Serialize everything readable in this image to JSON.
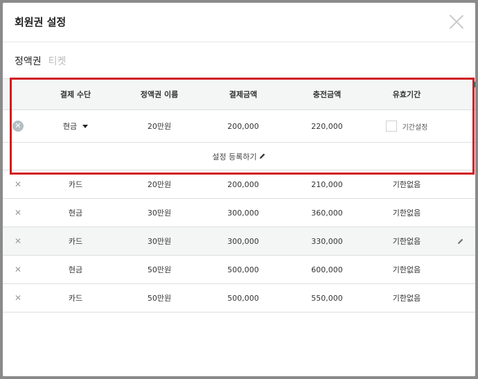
{
  "modal": {
    "title": "회원권 설정",
    "close_icon": "close-icon"
  },
  "tabs": [
    {
      "label": "정액권",
      "active": true
    },
    {
      "label": "티켓",
      "active": false
    }
  ],
  "table": {
    "headers": [
      "결제 수단",
      "정액권 이름",
      "결제금액",
      "충전금액",
      "유효기간"
    ],
    "input_row": {
      "payment_method": "현금",
      "name": "20만원",
      "payment_amount": "200,000",
      "charge_amount": "220,000",
      "period_label": "기간설정"
    },
    "register_label": "설정 등록하기",
    "rows": [
      {
        "payment": "카드",
        "name": "20만원",
        "amount": "200,000",
        "charge": "210,000",
        "period": "기한없음"
      },
      {
        "payment": "현금",
        "name": "30만원",
        "amount": "300,000",
        "charge": "360,000",
        "period": "기한없음"
      },
      {
        "payment": "카드",
        "name": "30만원",
        "amount": "300,000",
        "charge": "330,000",
        "period": "기한없음"
      },
      {
        "payment": "현금",
        "name": "50만원",
        "amount": "500,000",
        "charge": "600,000",
        "period": "기한없음"
      },
      {
        "payment": "카드",
        "name": "50만원",
        "amount": "500,000",
        "charge": "550,000",
        "period": "기한없음"
      }
    ],
    "highlighted_row": 2
  },
  "colors": {
    "highlight_border": "#d0181e",
    "header_bg": "#f4f6f6",
    "inactive_tab": "#bbbbbb"
  }
}
